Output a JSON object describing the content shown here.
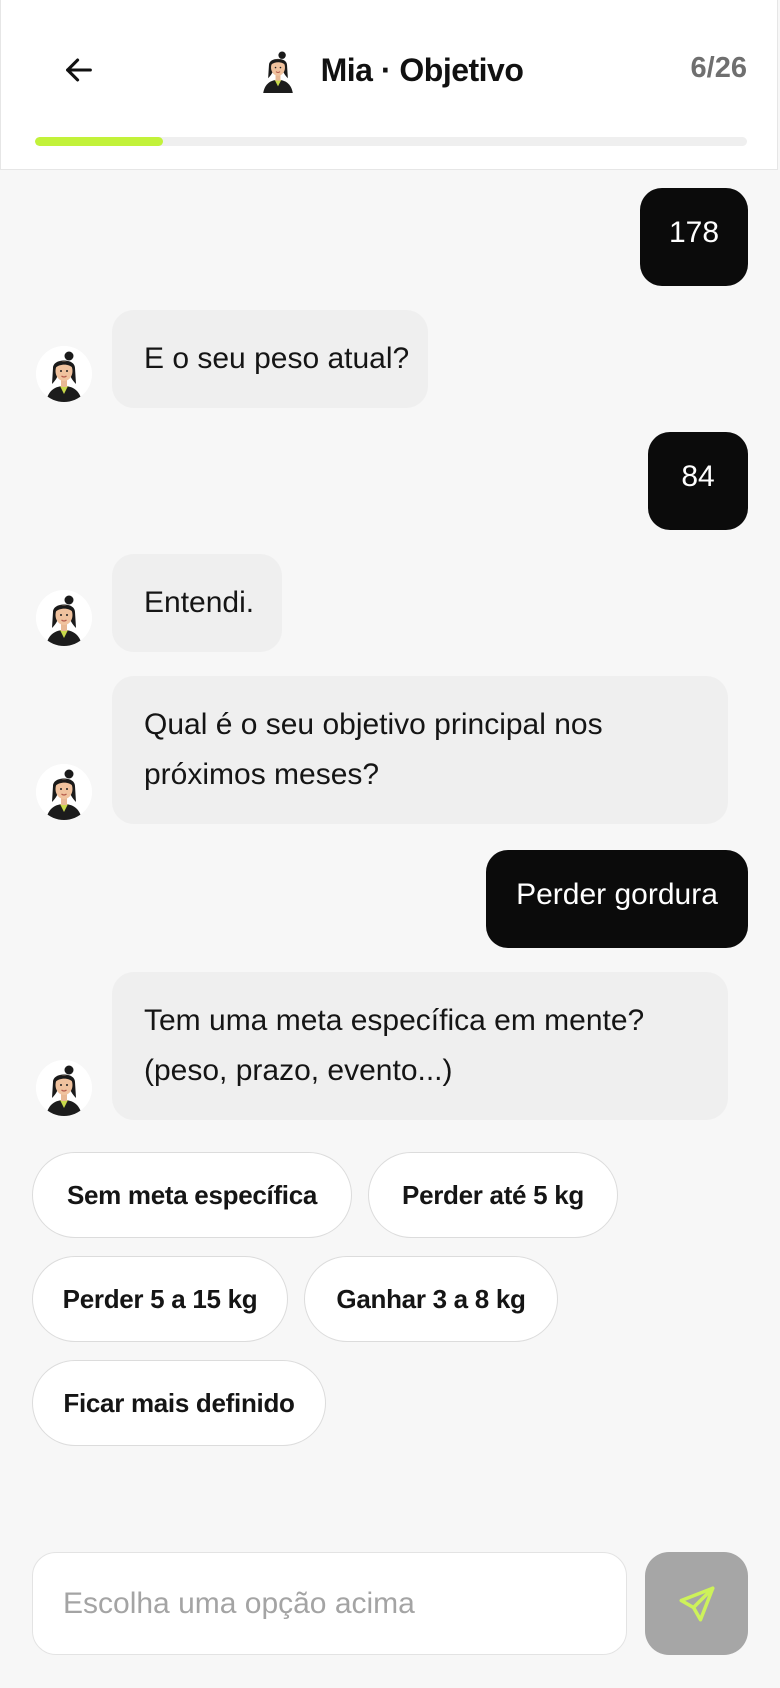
{
  "header": {
    "title": "Mia · Objetivo",
    "step": "6/26",
    "progress_fraction": 0.18,
    "accent_color": "#c2f23a",
    "back_icon": "arrow-left-icon"
  },
  "messages": [
    {
      "from": "user",
      "text": "178"
    },
    {
      "from": "bot",
      "text": "E o seu peso atual?"
    },
    {
      "from": "user",
      "text": "84"
    },
    {
      "from": "bot",
      "text": "Entendi."
    },
    {
      "from": "bot",
      "lines": [
        "Qual é o seu objetivo principal nos",
        "próximos meses?"
      ]
    },
    {
      "from": "user",
      "text": "Perder gordura"
    },
    {
      "from": "bot",
      "lines": [
        "Tem uma meta específica em mente?",
        "(peso, prazo, evento...)"
      ]
    }
  ],
  "options": [
    "Sem meta específica",
    "Perder até 5 kg",
    "Perder 5 a 15 kg",
    "Ganhar 3 a 8 kg",
    "Ficar mais definido"
  ],
  "composer": {
    "placeholder": "Escolha uma opção acima",
    "send_icon": "send-icon"
  }
}
